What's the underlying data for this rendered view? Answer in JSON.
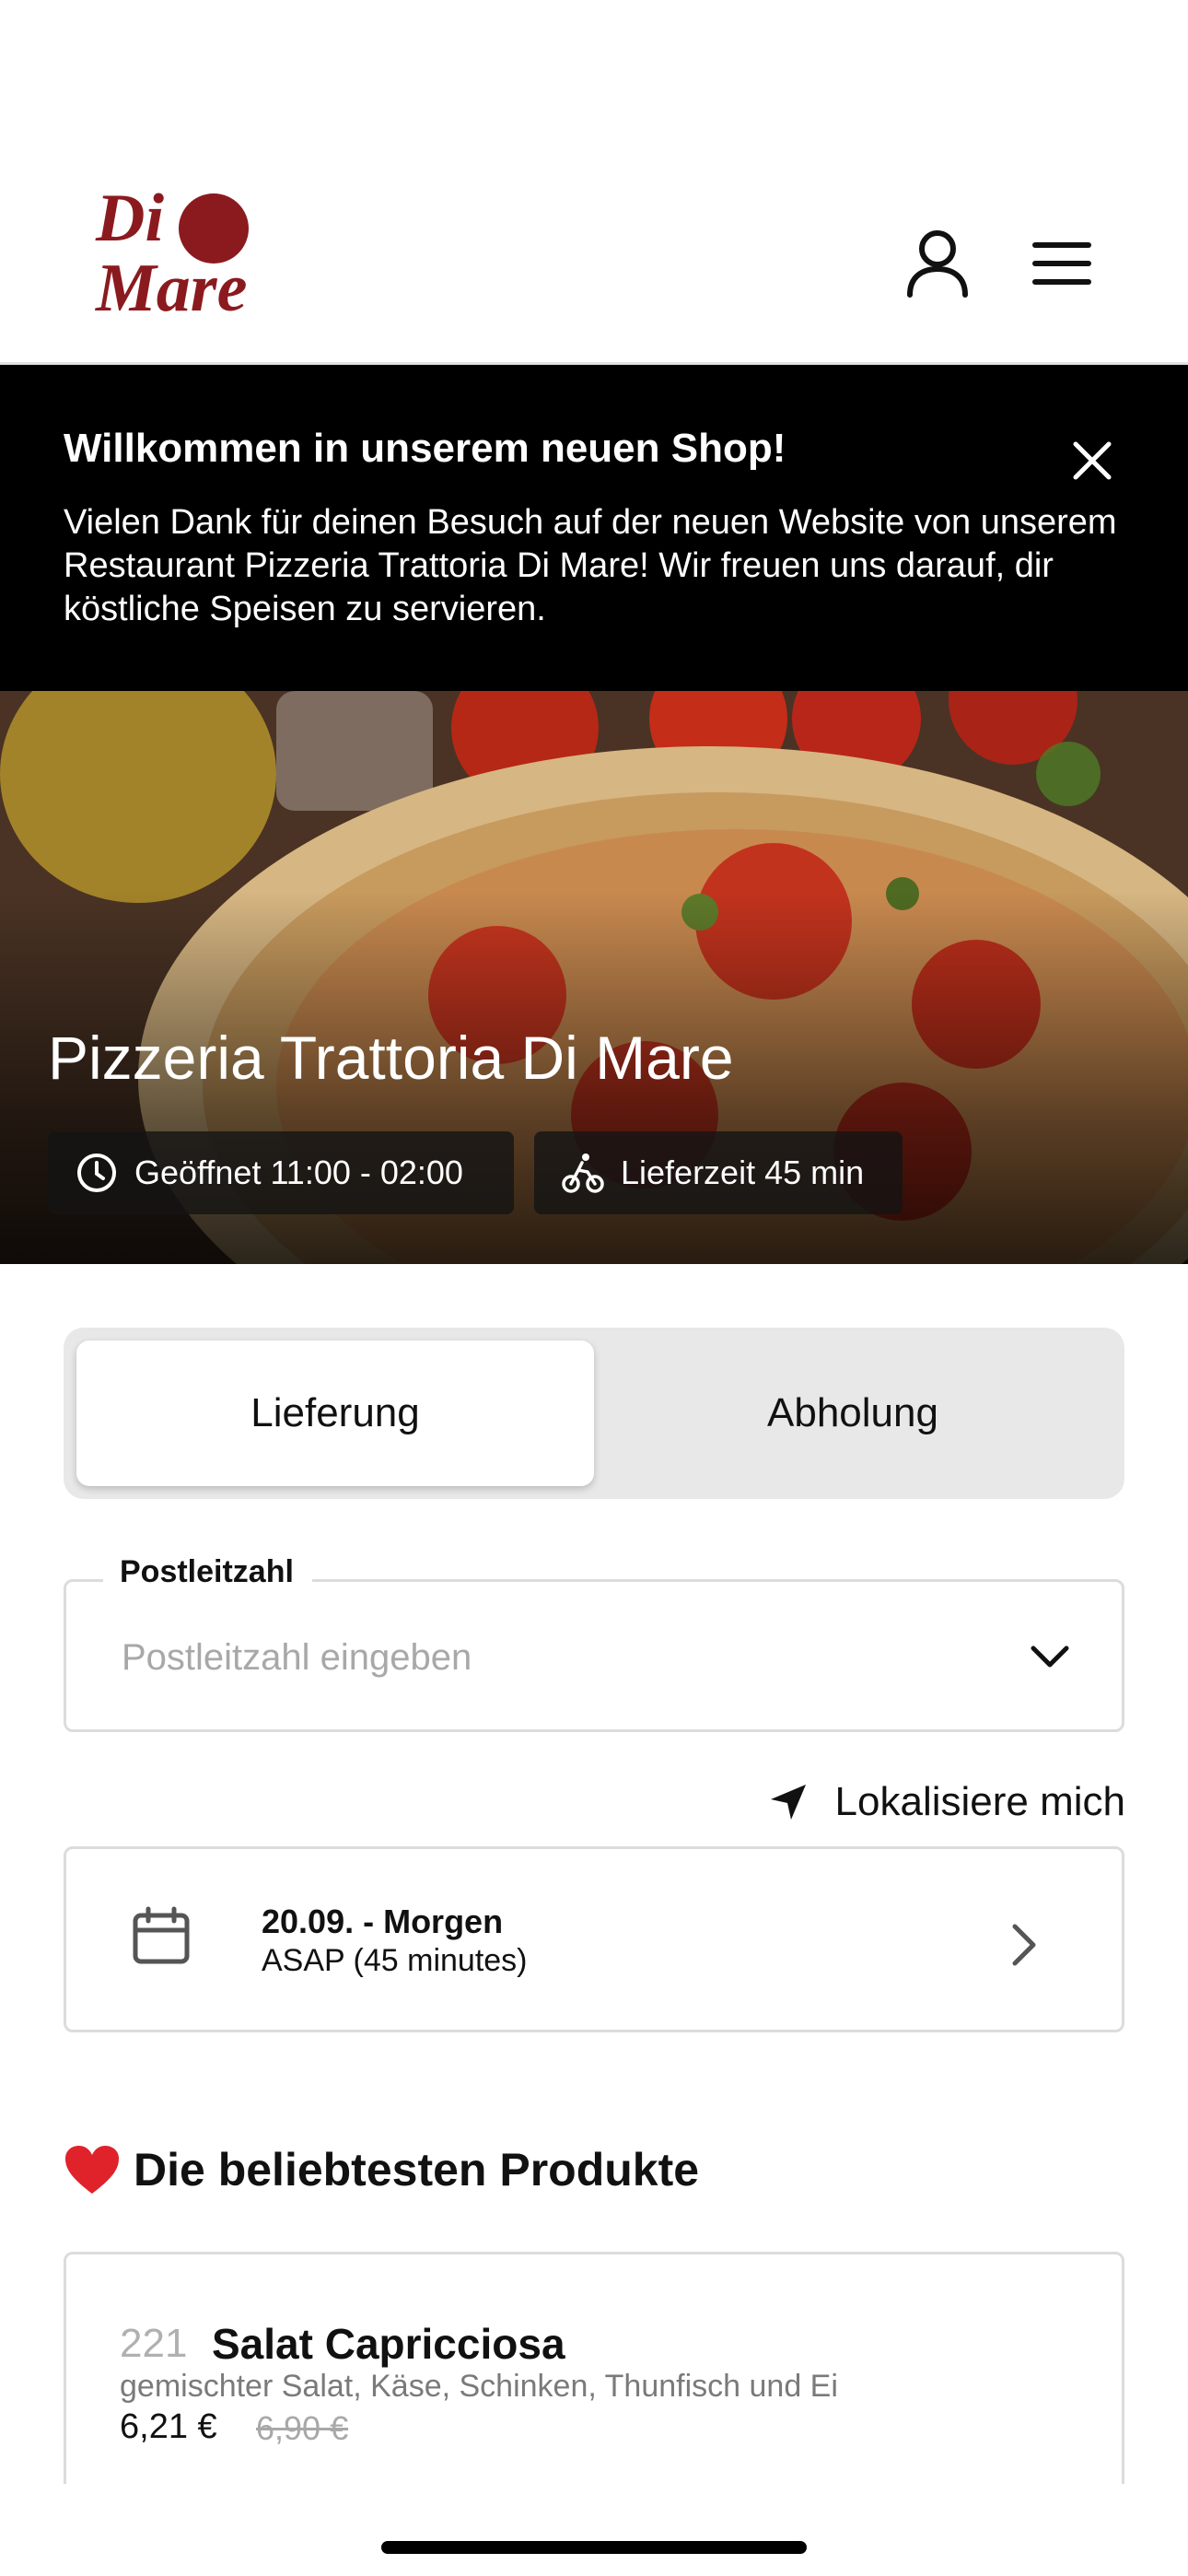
{
  "header": {
    "logo_line1": "Di",
    "logo_line2": "Mare",
    "user_icon": "user-icon",
    "menu_icon": "hamburger-menu-icon"
  },
  "banner": {
    "title": "Willkommen in unserem neuen Shop!",
    "text": "Vielen Dank für deinen Besuch auf der neuen Website von unserem Restaurant Pizzeria Trattoria Di Mare! Wir freuen uns darauf, dir köstliche Speisen zu servieren.",
    "close_icon": "close-icon"
  },
  "hero": {
    "restaurant_name": "Pizzeria Trattoria Di Mare",
    "opening_hours": "Geöffnet 11:00 - 02:00",
    "delivery_time": "Lieferzeit 45 min",
    "opening_icon": "clock-icon",
    "delivery_icon": "bicycle-courier-icon"
  },
  "order_mode": {
    "options": [
      "Lieferung",
      "Abholung"
    ],
    "selected": "Lieferung"
  },
  "postcode": {
    "label": "Postleitzahl",
    "placeholder": "Postleitzahl eingeben",
    "value": ""
  },
  "locate": {
    "label": "Lokalisiere mich",
    "icon": "location-arrow-icon"
  },
  "schedule": {
    "date": "20.09. - Morgen",
    "time": "ASAP (45 minutes)",
    "icon": "calendar-icon"
  },
  "popular": {
    "title": "Die beliebtesten Produkte",
    "icon": "heart-icon",
    "products": [
      {
        "number": "221",
        "name": "Salat Capricciosa",
        "description": "gemischter Salat, Käse, Schinken, Thunfisch und Ei",
        "price": "6,21 €",
        "old_price": "6,90 €"
      }
    ]
  },
  "colors": {
    "brand": "#8b1a1f",
    "banner_bg": "#000000",
    "segment_bg": "#e8e8e8"
  }
}
